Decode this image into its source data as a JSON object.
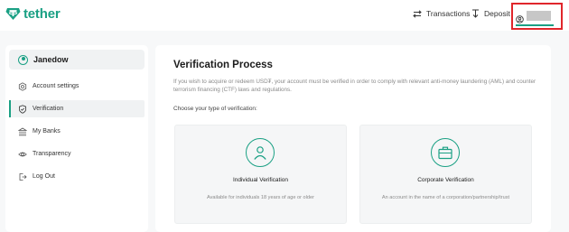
{
  "brand": {
    "name": "tether",
    "color": "#1aa084"
  },
  "topnav": {
    "transactions_label": "Transactions",
    "deposit_label": "Deposit",
    "transactions_icon": "swap-arrows-icon",
    "deposit_icon": "deposit-arrow-icon",
    "user_icon": "user-circle-icon",
    "highlight_color": "#e0262b"
  },
  "sidebar": {
    "username": "Janedow",
    "items": [
      {
        "label": "Account settings",
        "icon": "settings-icon",
        "active": false
      },
      {
        "label": "Verification",
        "icon": "shield-check-icon",
        "active": true
      },
      {
        "label": "My Banks",
        "icon": "bank-icon",
        "active": false
      },
      {
        "label": "Transparency",
        "icon": "eye-icon",
        "active": false
      },
      {
        "label": "Log Out",
        "icon": "logout-icon",
        "active": false
      }
    ]
  },
  "main": {
    "title": "Verification Process",
    "description": "If you wish to acquire or redeem USD₮, your account must be verified in order to comply with relevant anti-money laundering (AML) and counter terrorism financing (CTF) laws and regulations.",
    "choose_label": "Choose your type of verification:",
    "cards": [
      {
        "title": "Individual Verification",
        "description": "Available for individuals 18 years of age or older",
        "icon": "person-icon"
      },
      {
        "title": "Corporate Verification",
        "description": "An account in the name of a corporation/partnership/trust",
        "icon": "briefcase-icon"
      }
    ]
  }
}
